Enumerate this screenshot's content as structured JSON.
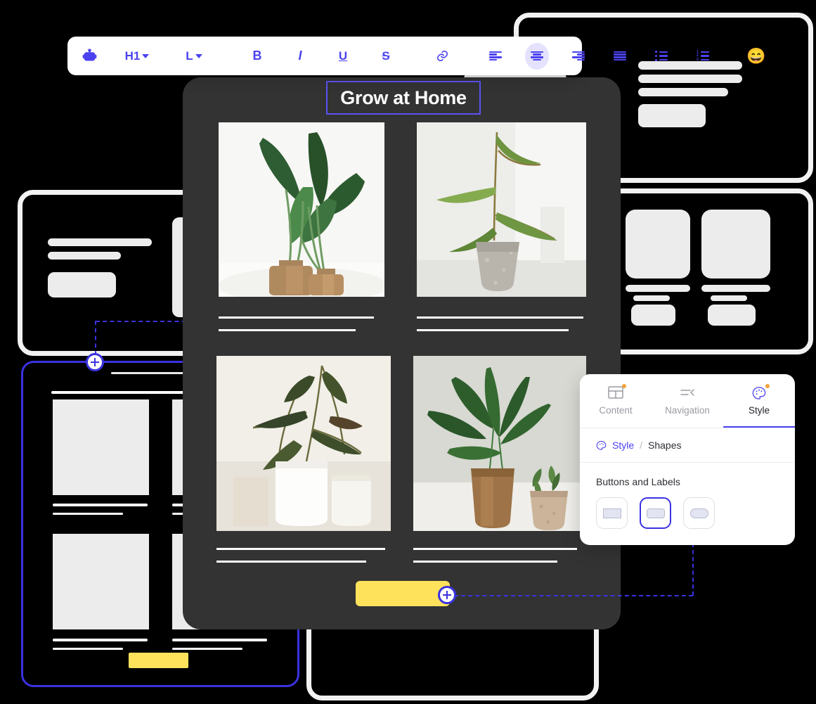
{
  "colors": {
    "accent": "#4b42ef",
    "accent_dark": "#3a32e0",
    "canvas_dark": "#333333",
    "cta_yellow": "#ffe25c",
    "badge_orange": "#f0a33c",
    "wireframe_gray": "#ececec"
  },
  "toolbar": {
    "items": [
      {
        "name": "ai-assistant-icon",
        "label": "",
        "icon": "robot-icon"
      },
      {
        "name": "heading-level-select",
        "label": "H1",
        "icon": "chevron-down-icon"
      },
      {
        "name": "text-size-select",
        "label": "L",
        "icon": "chevron-down-icon"
      },
      {
        "name": "bold-button",
        "label": "B",
        "icon": "bold-icon"
      },
      {
        "name": "italic-button",
        "label": "I",
        "icon": "italic-icon"
      },
      {
        "name": "underline-button",
        "label": "U",
        "icon": "underline-icon"
      },
      {
        "name": "strikethrough-button",
        "label": "S",
        "icon": "strikethrough-icon"
      },
      {
        "name": "link-button",
        "label": "",
        "icon": "link-icon"
      },
      {
        "name": "align-left-button",
        "label": "",
        "icon": "align-left-icon"
      },
      {
        "name": "align-center-button",
        "label": "",
        "icon": "align-center-icon"
      },
      {
        "name": "align-right-button",
        "label": "",
        "icon": "align-right-icon"
      },
      {
        "name": "align-justify-button",
        "label": "",
        "icon": "align-justify-icon"
      },
      {
        "name": "bulleted-list-button",
        "label": "",
        "icon": "bulleted-list-icon"
      },
      {
        "name": "numbered-list-button",
        "label": "",
        "icon": "numbered-list-icon"
      },
      {
        "name": "emoji-button",
        "label": "",
        "icon": "grinning-face-emoji"
      }
    ],
    "heading_level": "H1",
    "text_size": "L",
    "bold": "B",
    "italic": "I",
    "underline": "U",
    "strikethrough": "S",
    "emoji": "😄",
    "active_alignment": "align-center"
  },
  "canvas": {
    "heading": "Grow at Home",
    "heading_selected": true,
    "gallery": [
      {
        "name": "plant-photo-1",
        "alt": "Two wooden vases with broad green leaves"
      },
      {
        "name": "plant-photo-2",
        "alt": "Concrete pot with long curved leaves"
      },
      {
        "name": "plant-photo-3",
        "alt": "White ceramic pots with trailing plant"
      },
      {
        "name": "plant-photo-4",
        "alt": "Wooden vase with fern and succulent"
      }
    ],
    "cta_label": ""
  },
  "style_panel": {
    "tabs": [
      {
        "label": "Content",
        "icon": "layout-grid-icon",
        "selected": false,
        "badge": true
      },
      {
        "label": "Navigation",
        "icon": "collapse-menu-icon",
        "selected": false,
        "badge": false
      },
      {
        "label": "Style",
        "icon": "palette-icon",
        "selected": true,
        "badge": true
      }
    ],
    "breadcrumb": {
      "root": "Style",
      "separator": "/",
      "current": "Shapes",
      "icon": "palette-icon"
    },
    "section_title": "Buttons and Labels",
    "shapes": [
      {
        "name": "shape-square",
        "selected": false
      },
      {
        "name": "shape-rounded",
        "selected": true
      },
      {
        "name": "shape-pill",
        "selected": false
      }
    ]
  },
  "wireframes": {
    "top_right_panel": "hero-wireframe",
    "left_panel": "text-and-button-wireframe",
    "right_panel": "two-card-wireframe",
    "bottom_left_panel": "selected-article-list-wireframe",
    "bottom_right_panel": "empty-wireframe"
  }
}
